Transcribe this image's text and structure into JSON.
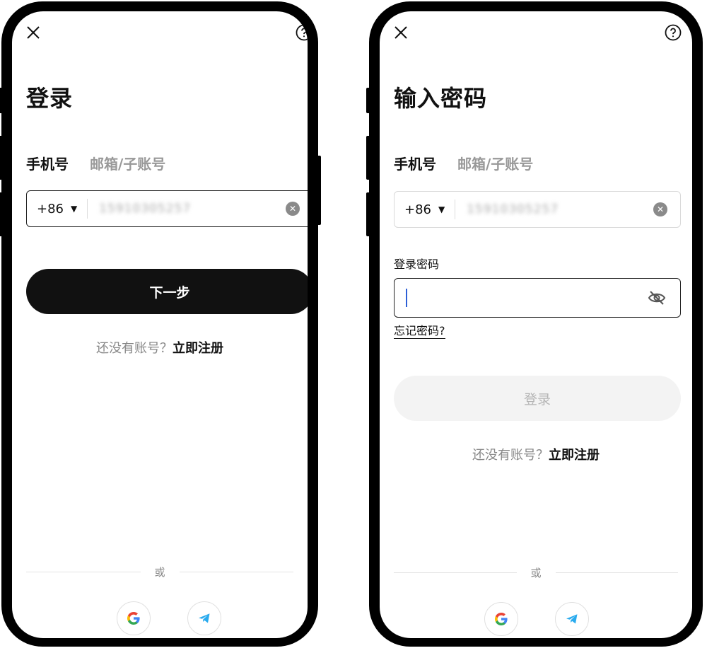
{
  "left_screen": {
    "title": "登录",
    "tabs": [
      {
        "label": "手机号",
        "active": true
      },
      {
        "label": "邮箱/子账号",
        "active": false
      }
    ],
    "country_code": "+86",
    "phone_value": "15910305257",
    "next_button": "下一步",
    "no_account_text": "还没有账号？",
    "register_link": "立即注册",
    "or_text": "或"
  },
  "right_screen": {
    "title": "输入密码",
    "tabs": [
      {
        "label": "手机号",
        "active": true
      },
      {
        "label": "邮箱/子账号",
        "active": false
      }
    ],
    "country_code": "+86",
    "phone_value": "15910305257",
    "password_label": "登录密码",
    "password_value": "",
    "forgot_password": "忘记密码?",
    "login_button": "登录",
    "no_account_text": "还没有账号？",
    "register_link": "立即注册",
    "or_text": "或"
  },
  "icons": {
    "close": "close-icon",
    "help": "help-icon",
    "dropdown": "triangle-down-icon",
    "clear": "clear-icon",
    "eye": "eye-off-icon",
    "google": "google-icon",
    "telegram": "telegram-icon"
  },
  "colors": {
    "primary": "#111111",
    "caret": "#2d5fd6",
    "google_blue": "#4285F4",
    "google_red": "#EA4335",
    "google_yellow": "#FBBC05",
    "google_green": "#34A853",
    "telegram_blue": "#2AABEE"
  }
}
